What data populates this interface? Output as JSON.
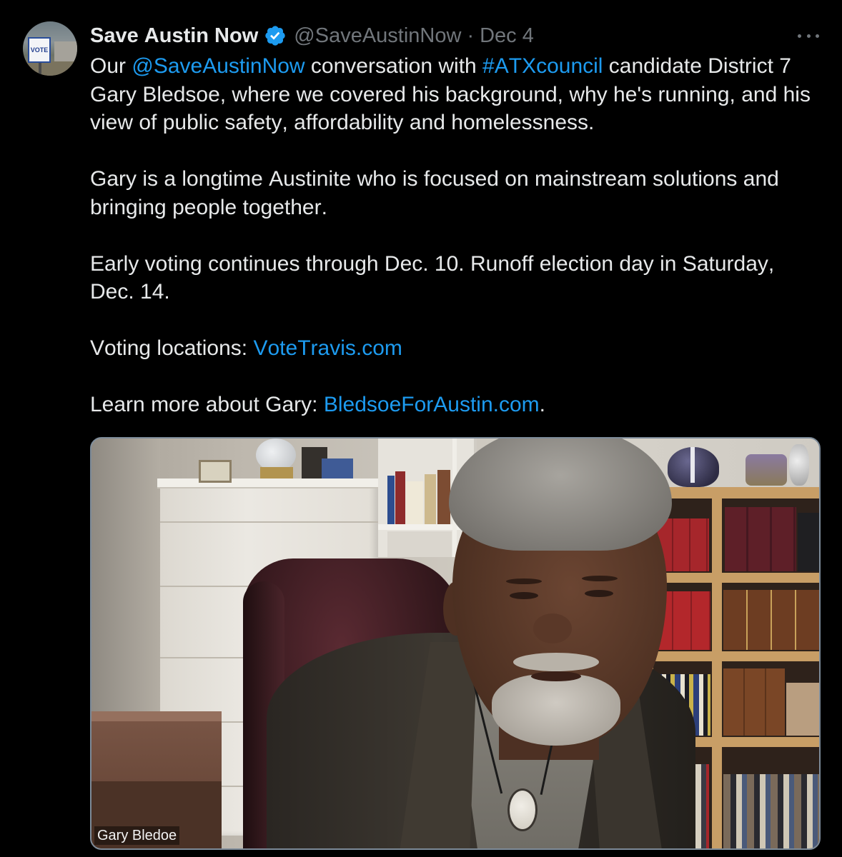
{
  "colors": {
    "background": "#000000",
    "text": "#e7e9ea",
    "secondary": "#71767b",
    "accent": "#1d9bf0"
  },
  "icons": {
    "verified": "verified-badge-icon",
    "more": "more-icon"
  },
  "tweet": {
    "author": {
      "name": "Save Austin Now",
      "handle": "@SaveAustinNow",
      "separator": "·",
      "date": "Dec 4",
      "avatar_sign_text": "VOTE"
    },
    "body": {
      "p1": {
        "t1": "Our ",
        "mention": "@SaveAustinNow",
        "t2": " conversation with ",
        "hashtag": "#ATXcouncil",
        "t3": " candidate District 7 Gary Bledsoe, where we covered his background, why he's running, and his view of public safety, affordability and homelessness."
      },
      "p2": "Gary is a longtime Austinite who is focused on mainstream solutions and bringing people together.",
      "p3": "Early voting continues through Dec. 10. Runoff election day in Saturday, Dec. 14.",
      "p4": {
        "label": "Voting locations: ",
        "link": "VoteTravis.com"
      },
      "p5": {
        "label": "Learn more about Gary: ",
        "link": "BledsoeForAustin.com",
        "suffix": "."
      }
    },
    "media": {
      "caption": "Gary Bledoe"
    }
  }
}
